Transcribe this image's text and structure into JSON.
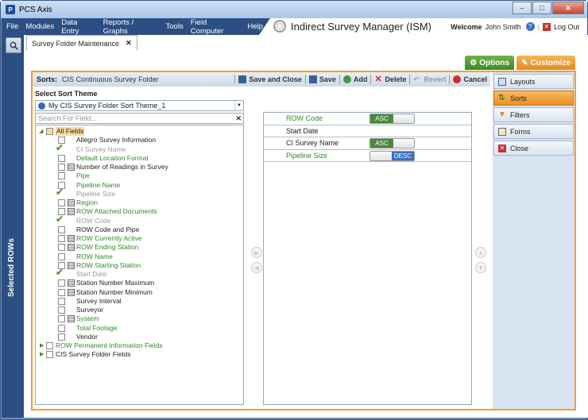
{
  "window": {
    "title": "PCS Axis",
    "app_icon": "P"
  },
  "menu": {
    "items": [
      "File",
      "Modules",
      "Data Entry",
      "Reports / Graphs",
      "Tools",
      "Field Computer",
      "Help"
    ],
    "app_name": "Indirect Survey Manager (ISM)",
    "welcome": "Welcome",
    "user": "John Smith",
    "logout": "Log Out"
  },
  "sidebar": {
    "selected_rows": "Selected ROWs"
  },
  "tab": {
    "label": "Survey Folder Maintenance"
  },
  "options": {
    "options_label": "Options",
    "customize_label": "Customize"
  },
  "toolbar": {
    "sorts_label": "Sorts:",
    "folder": "CIS Continuous Survey Folder",
    "save_close": "Save and Close",
    "save": "Save",
    "add": "Add",
    "delete": "Delete",
    "revert": "Revert",
    "cancel": "Cancel"
  },
  "left": {
    "select_theme_label": "Select Sort Theme",
    "theme_value": "My CIS Survey Folder Sort Theme_1",
    "search_placeholder": "Search For Field..."
  },
  "tree": [
    {
      "label": "All Fields",
      "color": "black",
      "kind": "root"
    },
    {
      "label": "Allegro Survey Information",
      "color": "black",
      "kind": "box"
    },
    {
      "label": "CI Survey Name",
      "color": "gray",
      "kind": "check"
    },
    {
      "label": "Default Location Format",
      "color": "green",
      "kind": "box"
    },
    {
      "label": "Number of Readings in Survey",
      "color": "black",
      "kind": "boxdoc"
    },
    {
      "label": "Pipe",
      "color": "green",
      "kind": "box"
    },
    {
      "label": "Pipeline Name",
      "color": "green",
      "kind": "box"
    },
    {
      "label": "Pipeline Size",
      "color": "gray",
      "kind": "check"
    },
    {
      "label": "Region",
      "color": "green",
      "kind": "boxdoc"
    },
    {
      "label": "ROW Attached Documents",
      "color": "green",
      "kind": "boxdoc"
    },
    {
      "label": "ROW Code",
      "color": "gray",
      "kind": "check"
    },
    {
      "label": "ROW Code and Pipe",
      "color": "black",
      "kind": "box"
    },
    {
      "label": "ROW Currently Active",
      "color": "green",
      "kind": "boxdoc"
    },
    {
      "label": "ROW Ending Station",
      "color": "green",
      "kind": "boxdoc"
    },
    {
      "label": "ROW Name",
      "color": "green",
      "kind": "box"
    },
    {
      "label": "ROW Starting Station",
      "color": "green",
      "kind": "boxdoc"
    },
    {
      "label": "Start Date",
      "color": "gray",
      "kind": "check"
    },
    {
      "label": "Station Number Maximum",
      "color": "black",
      "kind": "boxdoc"
    },
    {
      "label": "Station Number Minimum",
      "color": "black",
      "kind": "boxdoc"
    },
    {
      "label": "Survey Interval",
      "color": "black",
      "kind": "box"
    },
    {
      "label": "Surveyor",
      "color": "black",
      "kind": "box"
    },
    {
      "label": "System",
      "color": "green",
      "kind": "boxdoc"
    },
    {
      "label": "Total Footage",
      "color": "green",
      "kind": "box"
    },
    {
      "label": "Vendor",
      "color": "black",
      "kind": "box"
    },
    {
      "label": "ROW Permanent Information Fields",
      "color": "green",
      "kind": "group"
    },
    {
      "label": "CIS Survey Folder Fields",
      "color": "black",
      "kind": "group"
    }
  ],
  "sorts": [
    {
      "label": "ROW Code",
      "color": "green",
      "toggle": "ASC"
    },
    {
      "label": "Start Date",
      "color": "black",
      "toggle": ""
    },
    {
      "label": "CI Survey Name",
      "color": "black",
      "toggle": "ASC"
    },
    {
      "label": "Pipeline Size",
      "color": "green",
      "toggle": "DESC"
    }
  ],
  "rightnav": {
    "layouts": "Layouts",
    "sorts": "Sorts",
    "filters": "Filters",
    "forms": "Forms",
    "close": "Close"
  },
  "colors": {
    "accent_orange": "#f0a030",
    "nav_blue": "#2c4f83",
    "green": "#2e8b2a"
  }
}
